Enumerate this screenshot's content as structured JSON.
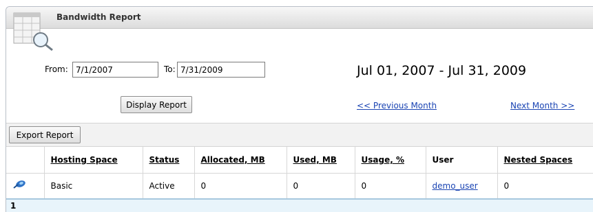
{
  "panel": {
    "title": "Bandwidth Report",
    "icon": "report-magnifier-icon"
  },
  "filters": {
    "from_label": "From:",
    "from_value": "7/1/2007",
    "to_label": "To:",
    "to_value": "7/31/2009",
    "date_range_text": "Jul 01, 2007 - Jul 31, 2009"
  },
  "actions": {
    "display_report": "Display Report",
    "previous_month": "<< Previous Month",
    "next_month": "Next Month >>",
    "export_report": "Export Report"
  },
  "table": {
    "columns": [
      "",
      "Hosting Space",
      "Status",
      "Allocated, MB",
      "Used, MB",
      "Usage, %",
      "User",
      "Nested Spaces"
    ],
    "rows": [
      {
        "icon": "hosting-space-icon",
        "hosting_space": "Basic",
        "status": "Active",
        "allocated_mb": "0",
        "used_mb": "0",
        "usage_pct": "0",
        "user": "demo_user",
        "nested_spaces": "0"
      }
    ]
  },
  "pager": {
    "current_page": "1"
  },
  "colors": {
    "link": "#1a44b3",
    "pager_bg": "#e8f4fb",
    "title_bar": "#dcdcdc"
  }
}
